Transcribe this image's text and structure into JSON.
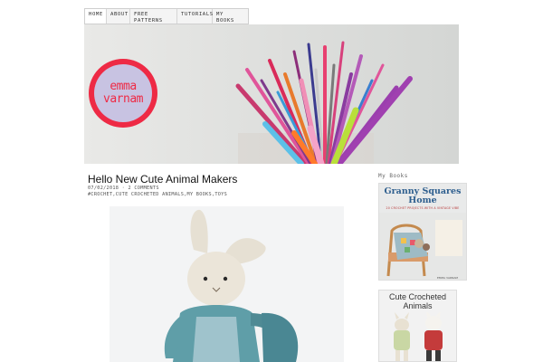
{
  "nav": {
    "items": [
      "HOME",
      "ABOUT",
      "FREE PATTERNS",
      "TUTORIALS",
      "MY BOOKS"
    ]
  },
  "header": {
    "logo_line1": "emma",
    "logo_line2": "varnam",
    "colors": {
      "logo_ring": "#ee2a45",
      "logo_fill": "#c8c3e2"
    }
  },
  "post": {
    "title": "Hello New Cute Animal Makers",
    "date": "07/02/2018",
    "comments": "2 COMMENTS",
    "tags": "#CROCHET,CUTE CROCHETED ANIMALS,MY BOOKS,TOYS"
  },
  "sidebar": {
    "heading": "My Books",
    "book1": {
      "title_line1": "Granny Squares",
      "title_line2": "Home",
      "subtitle": "20 CROCHET PROJECTS WITH A VINTAGE VIBE",
      "author": "EMMA VARNAM"
    },
    "book2": {
      "title_line1": "Cute Crocheted",
      "title_line2": "Animals"
    }
  }
}
